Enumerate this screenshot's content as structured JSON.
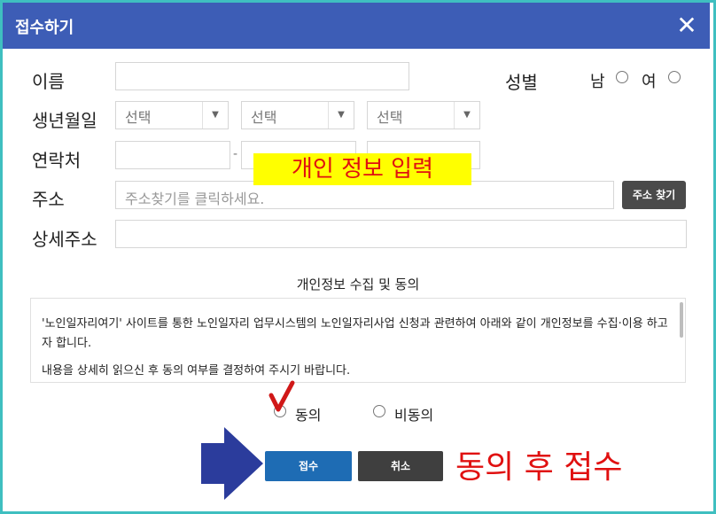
{
  "dialog": {
    "title": "접수하기",
    "close": "✕"
  },
  "form": {
    "name_label": "이름",
    "gender_label": "성별",
    "gender_male": "남",
    "gender_female": "여",
    "birth_label": "생년월일",
    "birth_selects": [
      "선택",
      "선택",
      "선택"
    ],
    "phone_label": "연락처",
    "phone_dash": "-",
    "address_label": "주소",
    "address_placeholder": "주소찾기를 클릭하세요.",
    "address_button": "주소 찾기",
    "detail_address_label": "상세주소"
  },
  "consent": {
    "title": "개인정보 수집 및 동의",
    "paragraph1": "'노인일자리여기' 사이트를 통한 노인일자리 업무시스템의 노인일자리사업 신청과 관련하여 아래와 같이 개인정보를 수집·이용 하고자 합니다.",
    "paragraph2": "내용을 상세히 읽으신 후 동의 여부를 결정하여 주시기 바랍니다.",
    "agree": "동의",
    "disagree": "비동의"
  },
  "buttons": {
    "submit": "접수",
    "cancel": "취소"
  },
  "annotations": {
    "banner": "개인 정보 입력",
    "bottom_text": "동의 후 접수",
    "banner_bg": "#ffff00",
    "text_color": "#e01010",
    "arrow_color": "#2b3c9c",
    "check_color": "#d01818"
  },
  "colors": {
    "titlebar": "#3d5db6",
    "border": "#3fbfc0",
    "submit_btn": "#1e6cb4",
    "cancel_btn": "#3f3f3f"
  }
}
